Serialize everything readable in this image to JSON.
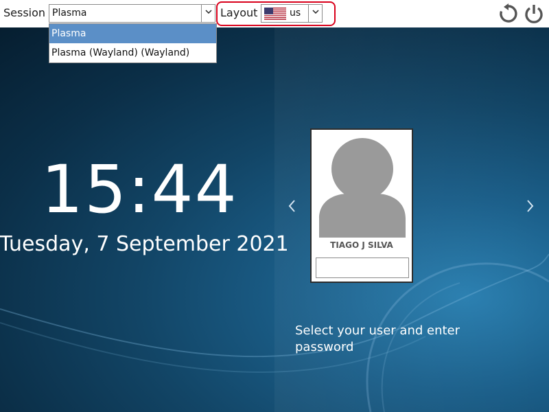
{
  "topbar": {
    "session_label": "Session",
    "session_value": "Plasma",
    "layout_label": "Layout",
    "layout_value": "us",
    "layout_flag_icon": "us-flag-icon"
  },
  "session_dropdown": {
    "options": [
      "Plasma",
      "Plasma (Wayland) (Wayland)"
    ],
    "selected_index": 0
  },
  "main": {
    "time": "15:44",
    "date": "Tuesday, 7 September 2021",
    "user_name": "TIAGO J SILVA",
    "password_value": "",
    "prompt": "Select your user and enter password"
  },
  "icons": {
    "reboot": "reboot-icon",
    "power": "power-icon",
    "prev": "chevron-left-icon",
    "next": "chevron-right-icon",
    "avatar": "user-avatar-icon"
  },
  "colors": {
    "highlight": "#5b8fc7",
    "layout_outline": "#d9001b",
    "background_dark": "#0b2f48",
    "background_light": "#2a7fb0"
  }
}
